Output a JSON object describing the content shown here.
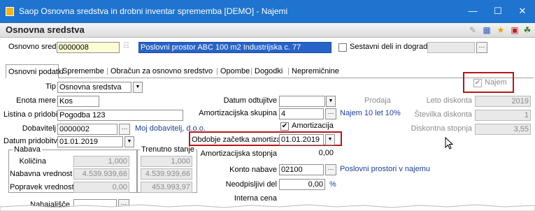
{
  "window": {
    "title": "Saop Osnovna sredstva in drobni inventar sprememba [DEMO] - Najemi",
    "controls": {
      "minimize": "—",
      "maximize": "☐",
      "close": "✕"
    }
  },
  "header": {
    "title": "Osnovna sredstva",
    "toolbar_icons": [
      "brush-icon",
      "grid-icon",
      "star-icon",
      "pdf-icon",
      "tree-icon"
    ]
  },
  "asset": {
    "label": "Osnovno sredstvo",
    "code": "0000008",
    "name": "Poslovni prostor ABC 100 m2 Industrijska c. 77",
    "components_label": "Sestavni deli in dograditve"
  },
  "tabs": [
    "Osnovni podatki",
    "Spremembe",
    "Obračun za osnovno sredstvo",
    "Opombe",
    "Dogodki",
    "Nepremičnine"
  ],
  "form": {
    "tip": {
      "label": "Tip",
      "value": "Osnovna sredstva"
    },
    "enota_mere": {
      "label": "Enota mere",
      "value": "Kos"
    },
    "listina": {
      "label": "Listina o pridobitvi",
      "value": "Pogodba 123"
    },
    "dobavitelj": {
      "label": "Dobavitelj",
      "value": "0000002",
      "name": "Moj dobavitelj, d.o.o."
    },
    "datum_pridobitve": {
      "label": "Datum pridobitve",
      "value": "01.01.2019"
    },
    "nabava": {
      "title": "Nabava",
      "kolicina_label": "Količina",
      "kolicina": "1,000",
      "nabavna_label": "Nabavna vrednost",
      "nabavna": "4.539.939,66",
      "popravek_label": "Popravek vrednosti",
      "popravek": "0,00"
    },
    "trenutno": {
      "title": "Trenutno stanje",
      "kolicina": "1,000",
      "nabavna": "4.539.939,66",
      "popravek": "453.993,97"
    },
    "nahajalisce": {
      "label": "Nahajališče",
      "value": ""
    },
    "datum_odtujitve": {
      "label": "Datum odtujitve",
      "value": ""
    },
    "amortizacijska_skupina": {
      "label": "Amortizacijska skupina",
      "value": "4",
      "name": "Najem 10 let 10%"
    },
    "amortizacija": {
      "label": "Amortizacija",
      "checked": true
    },
    "obdobje": {
      "label": "Obdobje začetka amortizacije",
      "value": "01.01.2019"
    },
    "stopnja": {
      "label": "Amortizacijska stopnja",
      "value": "0,00"
    },
    "konto": {
      "label": "Konto nabave",
      "value": "02100",
      "name": "Poslovni prostori v najemu"
    },
    "neodpisljivi": {
      "label": "Neodpisljivi del",
      "value": "0,00",
      "unit": "%"
    },
    "interna_cena": {
      "label": "Interna cena",
      "value": ""
    },
    "prodaja": {
      "label": "Prodaja"
    },
    "leto_diskonta": {
      "label": "Leto diskonta",
      "value": "2019"
    },
    "stevilka_diskonta": {
      "label": "Številka diskonta",
      "value": "1"
    },
    "diskontna_stopnja": {
      "label": "Diskontna stopnja",
      "value": "3,55"
    },
    "najem": {
      "label": "Najem",
      "checked": true
    }
  }
}
